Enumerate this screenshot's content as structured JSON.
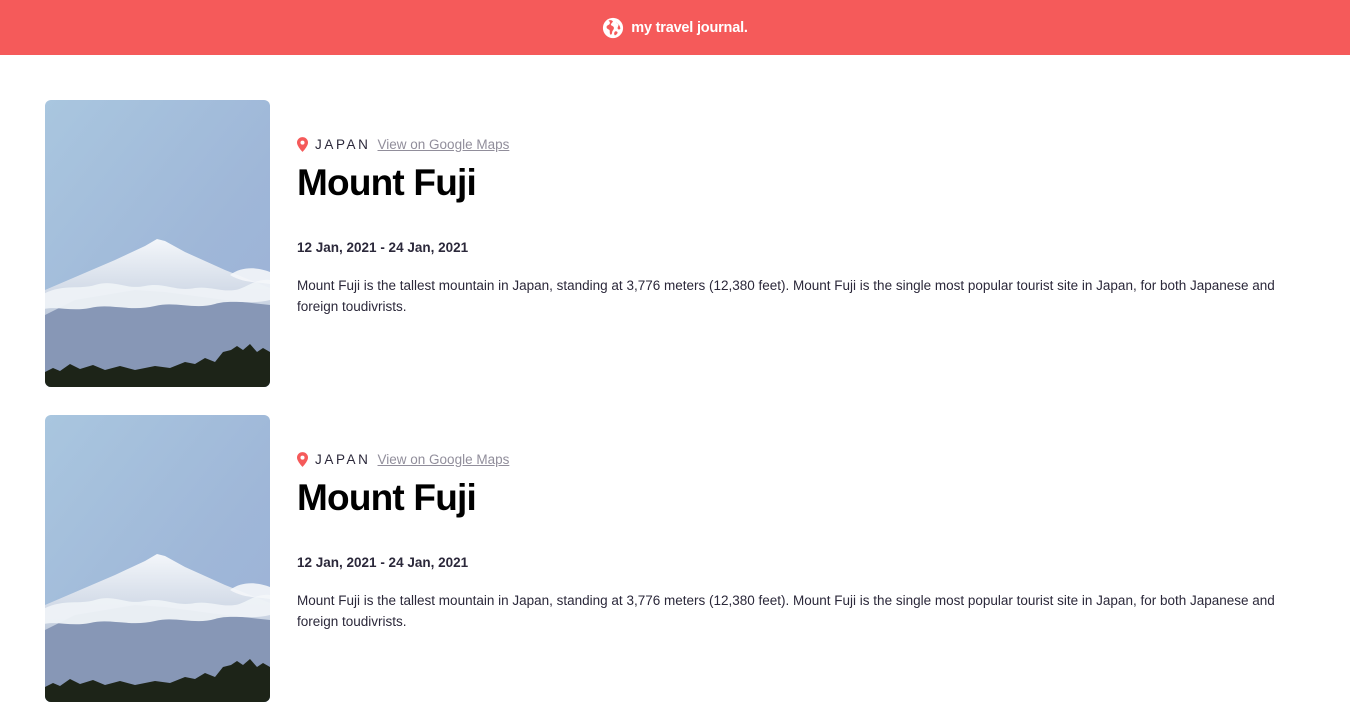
{
  "navbar": {
    "brand": "my travel journal.",
    "icon": "globe-icon",
    "background": "#f55a5a"
  },
  "entries": [
    {
      "location": "JAPAN",
      "maps_label": "View on Google Maps",
      "title": "Mount Fuji",
      "dates": "12 Jan, 2021 - 24 Jan, 2021",
      "description": "Mount Fuji is the tallest mountain in Japan, standing at 3,776 meters (12,380 feet). Mount Fuji is the single most popular tourist site in Japan, for both Japanese and foreign toudivrists."
    },
    {
      "location": "JAPAN",
      "maps_label": "View on Google Maps",
      "title": "Mount Fuji",
      "dates": "12 Jan, 2021 - 24 Jan, 2021",
      "description": "Mount Fuji is the tallest mountain in Japan, standing at 3,776 meters (12,380 feet). Mount Fuji is the single most popular tourist site in Japan, for both Japanese and foreign toudivrists."
    }
  ],
  "colors": {
    "accent": "#f55a5a",
    "link": "#918e9b",
    "text": "#2b283a"
  }
}
